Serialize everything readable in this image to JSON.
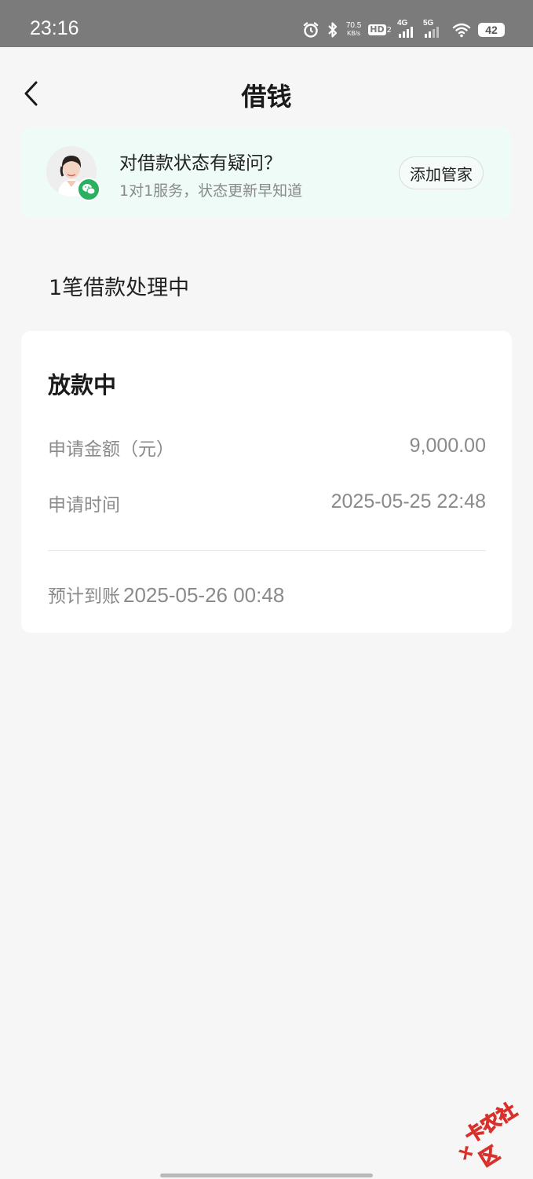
{
  "status_bar": {
    "time": "23:16",
    "net_speed_value": "70.5",
    "net_speed_unit": "KB/s",
    "hd_label": "HD",
    "hd_sub": "2",
    "sim1_label": "4G",
    "sim2_label": "5G",
    "battery": "42"
  },
  "header": {
    "title": "借钱"
  },
  "butler": {
    "title": "对借款状态有疑问？",
    "subtitle": "1对1服务，状态更新早知道",
    "button_label": "添加管家"
  },
  "section": {
    "title": "1笔借款处理中"
  },
  "loan_card": {
    "status": "放款中",
    "amount_label": "申请金额（元）",
    "amount_value": "9,000.00",
    "time_label": "申请时间",
    "time_value": "2025-05-25 22:48",
    "arrival_label": "预计到账",
    "arrival_value": "2025-05-26 00:48"
  },
  "watermark": {
    "text": "卡农社区"
  },
  "colors": {
    "status_bar_bg": "#7b7b7b",
    "page_bg": "#f6f6f7",
    "banner_bg": "#eefbf6",
    "wechat_green": "#2bb061",
    "watermark_red": "#d8302b"
  }
}
